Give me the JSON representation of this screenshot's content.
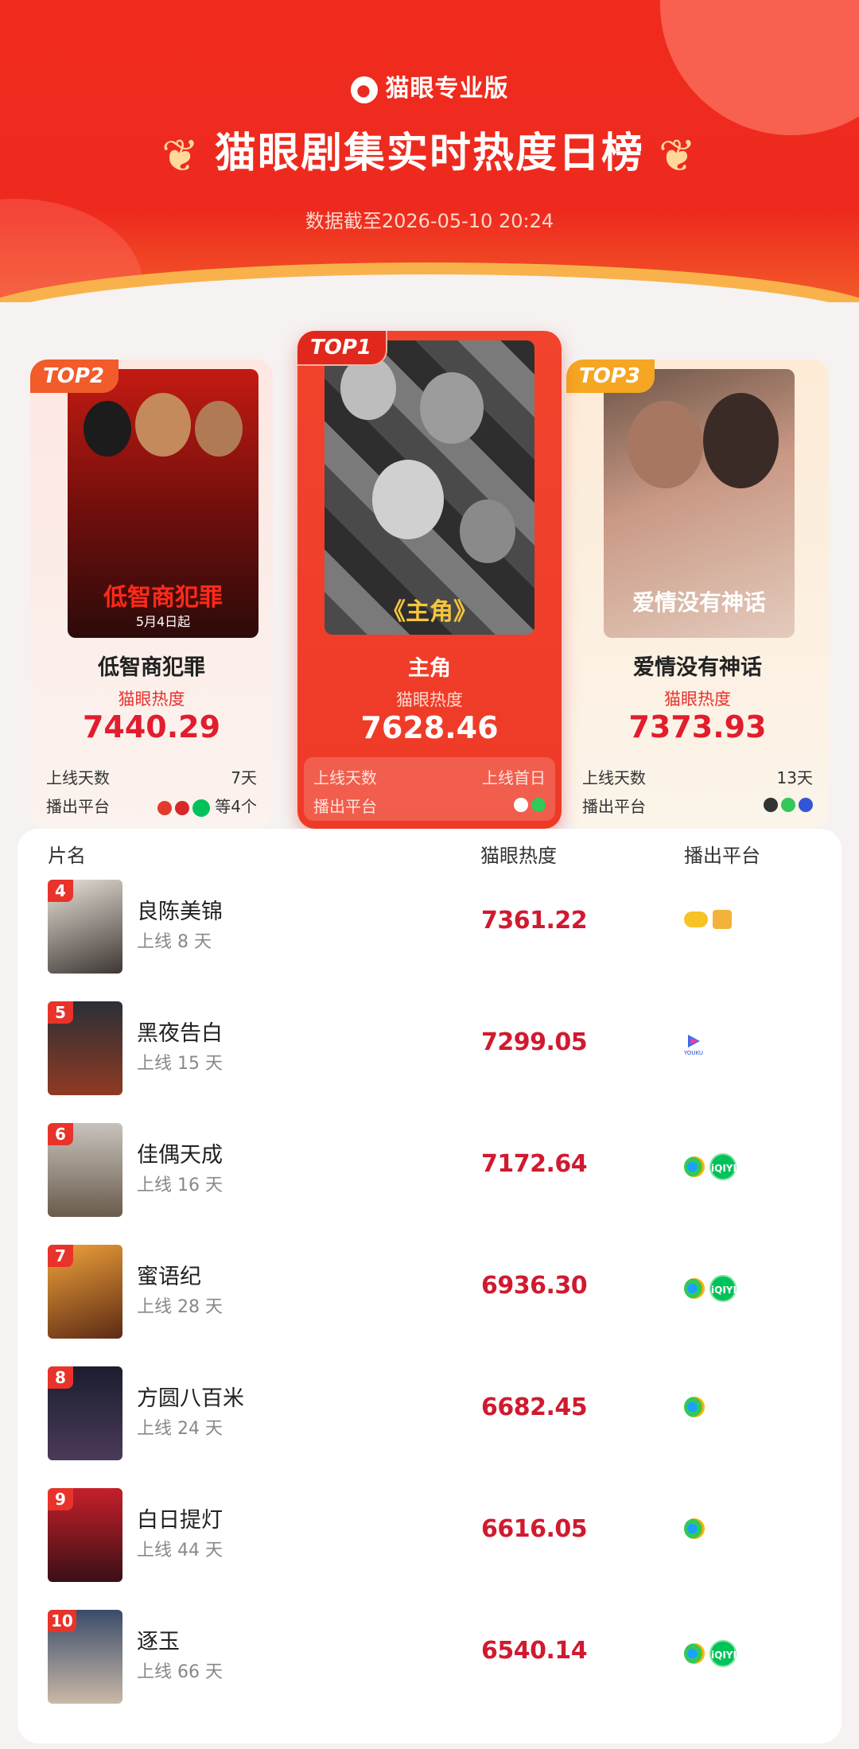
{
  "header": {
    "brand": "猫眼专业版",
    "title": "猫眼剧集实时热度日榜",
    "datetime": "数据截至2026-05-10 20:24"
  },
  "top": [
    {
      "rank_label": "TOP1",
      "name": "主角",
      "heat_label": "猫眼热度",
      "heat": "7628.46",
      "days_label": "上线天数",
      "days": "上线首日",
      "platform_label": "播出平台",
      "poster_title": "《主角》"
    },
    {
      "rank_label": "TOP2",
      "name": "低智商犯罪",
      "heat_label": "猫眼热度",
      "heat": "7440.29",
      "days_label": "上线天数",
      "days": "7天",
      "platform_label": "播出平台",
      "platform_more": "等4个",
      "poster_title": "低智商犯罪",
      "poster_sub": "5月4日起"
    },
    {
      "rank_label": "TOP3",
      "name": "爱情没有神话",
      "heat_label": "猫眼热度",
      "heat": "7373.93",
      "days_label": "上线天数",
      "days": "13天",
      "platform_label": "播出平台",
      "poster_title": "爱情没有神话"
    }
  ],
  "list": {
    "headers": {
      "name": "片名",
      "heat": "猫眼热度",
      "platform": "播出平台"
    },
    "rows": [
      {
        "rank": "4",
        "name": "良陈美锦",
        "days": "上线 8 天",
        "heat": "7361.22",
        "platforms": [
          "mango-icon",
          "mi-icon"
        ]
      },
      {
        "rank": "5",
        "name": "黑夜告白",
        "days": "上线 15 天",
        "heat": "7299.05",
        "platforms": [
          "youku-icon"
        ]
      },
      {
        "rank": "6",
        "name": "佳偶天成",
        "days": "上线 16 天",
        "heat": "7172.64",
        "platforms": [
          "tencent-video-icon",
          "iqiyi-icon"
        ]
      },
      {
        "rank": "7",
        "name": "蜜语纪",
        "days": "上线 28 天",
        "heat": "6936.30",
        "platforms": [
          "tencent-video-icon",
          "iqiyi-icon"
        ]
      },
      {
        "rank": "8",
        "name": "方圆八百米",
        "days": "上线 24 天",
        "heat": "6682.45",
        "platforms": [
          "tencent-video-icon"
        ]
      },
      {
        "rank": "9",
        "name": "白日提灯",
        "days": "上线 44 天",
        "heat": "6616.05",
        "platforms": [
          "tencent-video-icon"
        ]
      },
      {
        "rank": "10",
        "name": "逐玉",
        "days": "上线 66 天",
        "heat": "6540.14",
        "platforms": [
          "tencent-video-icon",
          "iqiyi-icon"
        ]
      }
    ]
  },
  "colors": {
    "brand_red": "#ee2a1e",
    "heat_red": "#d01a2f",
    "top3_orange": "#f5a623"
  }
}
